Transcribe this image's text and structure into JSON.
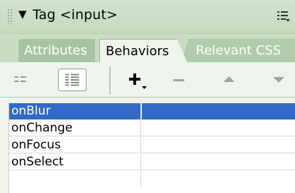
{
  "panel": {
    "title": "Tag <input>",
    "collapse_arrow": "▼",
    "options_icon": "options-menu-icon"
  },
  "tabs": [
    {
      "label": "Attributes"
    },
    {
      "label": "Behaviors"
    },
    {
      "label": "Relevant CSS"
    }
  ],
  "toolbar": {
    "show_set_events": "show-set-events-icon",
    "show_all_events": "show-all-events-icon",
    "add_behavior": "+",
    "remove_behavior": "−",
    "move_up": "▲",
    "move_down": "▼"
  },
  "events": [
    {
      "name": "onBlur",
      "action": ""
    },
    {
      "name": "onChange",
      "action": ""
    },
    {
      "name": "onFocus",
      "action": ""
    },
    {
      "name": "onSelect",
      "action": ""
    }
  ],
  "colors": {
    "selection": "#316ac5",
    "panel_bg": "#eef4ec"
  }
}
